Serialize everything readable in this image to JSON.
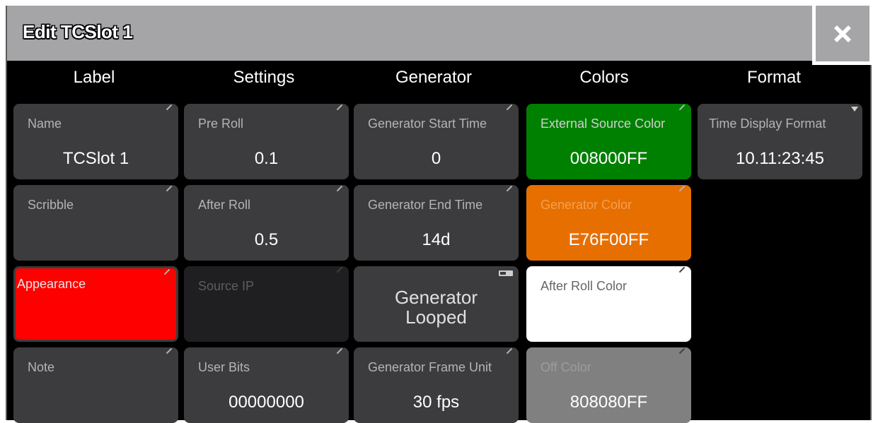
{
  "window": {
    "title": "Edit TCSlot 1"
  },
  "close_icon": "close-x-icon",
  "columns": {
    "label": "Label",
    "settings": "Settings",
    "generator": "Generator",
    "colors": "Colors",
    "format": "Format"
  },
  "label_col": {
    "name": {
      "label": "Name",
      "value": "TCSlot 1"
    },
    "scribble": {
      "label": "Scribble",
      "value": ""
    },
    "appearance": {
      "label": "Appearance",
      "color": "#ff0000"
    },
    "note": {
      "label": "Note",
      "value": ""
    }
  },
  "settings_col": {
    "pre_roll": {
      "label": "Pre Roll",
      "value": "0.1"
    },
    "after_roll": {
      "label": "After Roll",
      "value": "0.5"
    },
    "source_ip": {
      "label": "Source IP",
      "value": "",
      "disabled": true
    },
    "user_bits": {
      "label": "User Bits",
      "value": "00000000"
    }
  },
  "generator_col": {
    "start_time": {
      "label": "Generator Start Time",
      "value": "0"
    },
    "end_time": {
      "label": "Generator End Time",
      "value": "14d"
    },
    "looped": {
      "line1": "Generator",
      "line2": "Looped"
    },
    "frame_unit": {
      "label": "Generator Frame Unit",
      "value": "30 fps"
    }
  },
  "colors_col": {
    "external_source": {
      "label": "External Source Color",
      "value": "008000FF",
      "color": "#008000"
    },
    "generator": {
      "label": "Generator Color",
      "value": "E76F00FF",
      "color": "#e76f00"
    },
    "after_roll": {
      "label": "After Roll Color",
      "value": "",
      "color": "#ffffff"
    },
    "off": {
      "label": "Off Color",
      "value": "808080FF",
      "color": "#808080"
    }
  },
  "format_col": {
    "time_display": {
      "label": "Time Display Format",
      "value": "10.11:23:45"
    }
  },
  "theme": {
    "cell_bg": "#3c3c3e",
    "titlebar_bg": "#a5a5a7",
    "window_bg": "#000000"
  }
}
